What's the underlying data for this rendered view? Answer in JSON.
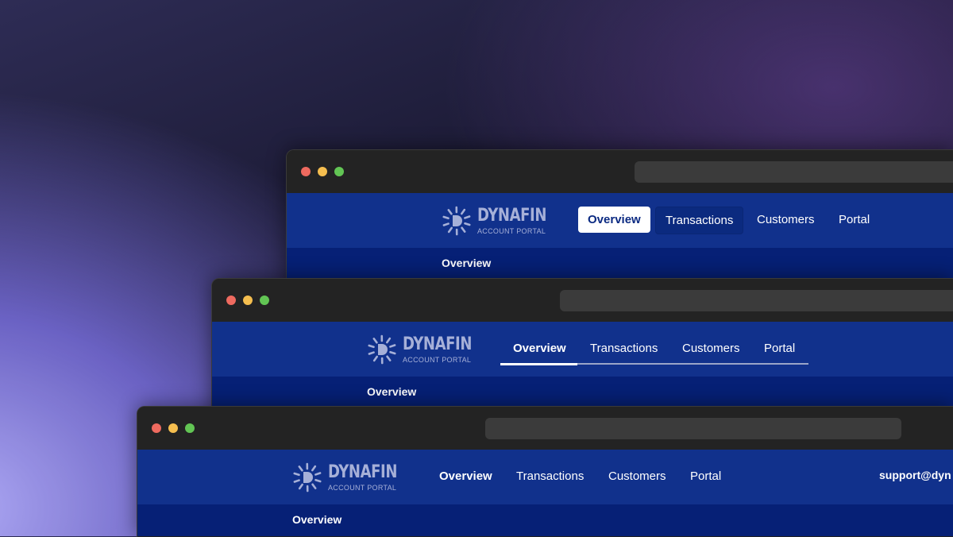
{
  "colors": {
    "titlebar": "#232323",
    "urlbar": "#3b3b3b",
    "navbar": "#11318c",
    "subbar": "#062076",
    "active_tab_bg": "#ffffff",
    "active_tab_text": "#0b2a82",
    "hover_tab_bg": "#0b2a7f",
    "nav_text": "#ffffff",
    "logo_color": "#a6b0d8",
    "tab_line": "#9aa5c8",
    "tl_red": "#ee6a5f",
    "tl_yellow": "#f5be4f",
    "tl_green": "#62c554"
  },
  "brand": {
    "name": "DYNAFIN",
    "tagline": "ACCOUNT PORTAL",
    "icon": "sun-d-logo-icon"
  },
  "windows": [
    {
      "variant": "pill-tabs",
      "nav": [
        {
          "label": "Overview",
          "state": "active"
        },
        {
          "label": "Transactions",
          "state": "hover"
        },
        {
          "label": "Customers",
          "state": "default"
        },
        {
          "label": "Portal",
          "state": "default"
        }
      ],
      "page_title": "Overview"
    },
    {
      "variant": "underline-tabs",
      "nav": [
        {
          "label": "Overview",
          "state": "active"
        },
        {
          "label": "Transactions",
          "state": "default"
        },
        {
          "label": "Customers",
          "state": "default"
        },
        {
          "label": "Portal",
          "state": "default"
        }
      ],
      "page_title": "Overview"
    },
    {
      "variant": "plain-links",
      "nav": [
        {
          "label": "Overview",
          "state": "active"
        },
        {
          "label": "Transactions",
          "state": "default"
        },
        {
          "label": "Customers",
          "state": "default"
        },
        {
          "label": "Portal",
          "state": "default"
        }
      ],
      "support_email": "support@dyn",
      "page_title": "Overview"
    }
  ]
}
